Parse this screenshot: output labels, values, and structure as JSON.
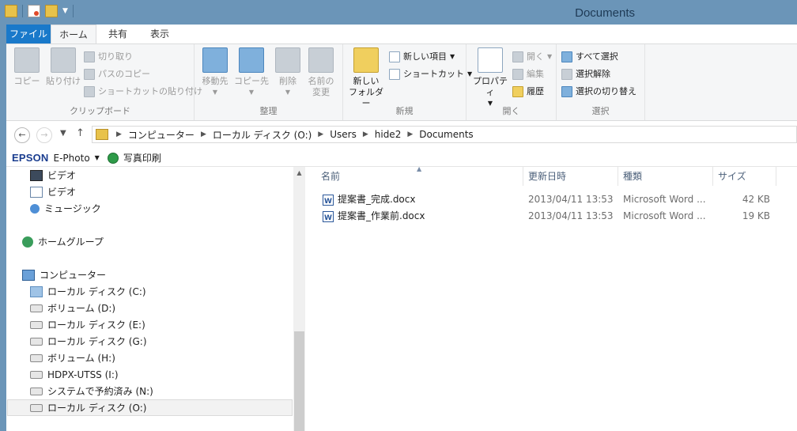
{
  "window": {
    "title": "Documents"
  },
  "tabs": [
    {
      "label": "ファイル"
    },
    {
      "label": "ホーム"
    },
    {
      "label": "共有"
    },
    {
      "label": "表示"
    }
  ],
  "ribbon": {
    "clipboard": {
      "label": "クリップボード",
      "copy": "コピー",
      "paste": "貼り付け",
      "cut": "切り取り",
      "copy_path": "パスのコピー",
      "paste_shortcut": "ショートカットの貼り付け"
    },
    "organize": {
      "label": "整理",
      "move_to": "移動先",
      "copy_to": "コピー先",
      "delete": "削除",
      "rename_line1": "名前の",
      "rename_line2": "変更"
    },
    "new": {
      "label": "新規",
      "new_folder_line1": "新しい",
      "new_folder_line2": "フォルダー",
      "new_item": "新しい項目",
      "shortcut": "ショートカット"
    },
    "open": {
      "label": "開く",
      "properties": "プロパティ",
      "open": "開く",
      "edit": "編集",
      "history": "履歴"
    },
    "select": {
      "label": "選択",
      "select_all": "すべて選択",
      "select_none": "選択解除",
      "invert": "選択の切り替え"
    }
  },
  "address": {
    "crumbs": [
      "コンピューター",
      "ローカル ディスク (O:)",
      "Users",
      "hide2",
      "Documents"
    ]
  },
  "epson": {
    "logo": "EPSON",
    "product": "E-Photo",
    "print": "写真印刷"
  },
  "navpane": {
    "items": [
      {
        "label": "ビデオ"
      },
      {
        "label": "ビデオ"
      },
      {
        "label": "ミュージック"
      },
      {
        "label": "ホームグループ"
      },
      {
        "label": "コンピューター"
      },
      {
        "label": "ローカル ディスク (C:)"
      },
      {
        "label": "ボリューム (D:)"
      },
      {
        "label": "ローカル ディスク (E:)"
      },
      {
        "label": "ローカル ディスク (G:)"
      },
      {
        "label": "ボリューム (H:)"
      },
      {
        "label": "HDPX-UTSS (I:)"
      },
      {
        "label": "システムで予約済み (N:)"
      },
      {
        "label": "ローカル ディスク (O:)"
      }
    ]
  },
  "files": {
    "columns": [
      "名前",
      "更新日時",
      "種類",
      "サイズ"
    ],
    "rows": [
      {
        "name": "提案書_完成.docx",
        "modified": "2013/04/11 13:53",
        "type": "Microsoft Word ...",
        "size": "42 KB"
      },
      {
        "name": "提案書_作業前.docx",
        "modified": "2013/04/11 13:53",
        "type": "Microsoft Word ...",
        "size": "19 KB"
      }
    ]
  }
}
